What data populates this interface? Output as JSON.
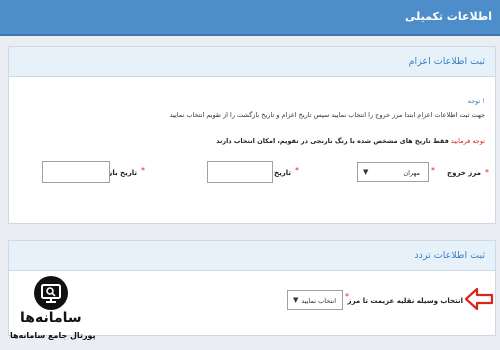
{
  "header": {
    "title": "اطلاعات تکمیلی"
  },
  "section1": {
    "title": "ثبت اطلاعات اعزام",
    "note_title": "! توجه",
    "note_text": "جهت ثبت اطلاعات اعزام ابتدا مرز خروج را انتخاب نمایید سپس تاریخ اعزام و تاریخ بازگشت را از تقویم انتخاب نمایید",
    "warning_prefix": "توجه فرمایید",
    "warning_text": "فقط تاریخ های مشخص شده با رنگ نارنجی در تقویم، امکان انتخاب دارند",
    "exit_border_label": "مرز خروج",
    "exit_border_value": "مهران",
    "dispatch_date_label": "تاریخ اعزام",
    "return_date_label": "تاریخ بازگشت",
    "required_mark": "*"
  },
  "section2": {
    "title": "ثبت اطلاعات تردد",
    "vehicle_label": "انتخاب وسیله نقلیه عزیمت تا مرز",
    "vehicle_value": "انتخاب نمایید",
    "required_mark": "*"
  },
  "watermark": {
    "name": "سامانه‌ها",
    "tagline": "پورتال جامع سامانه‌ها"
  },
  "colors": {
    "header": "#4d8dca",
    "accent": "#3d7fbf",
    "required": "#d9261c",
    "arrow": "#d9261c"
  },
  "icons": {
    "select": "chevron-down-icon",
    "pointer": "arrow-left-icon",
    "logo": "monitor-search-icon"
  }
}
